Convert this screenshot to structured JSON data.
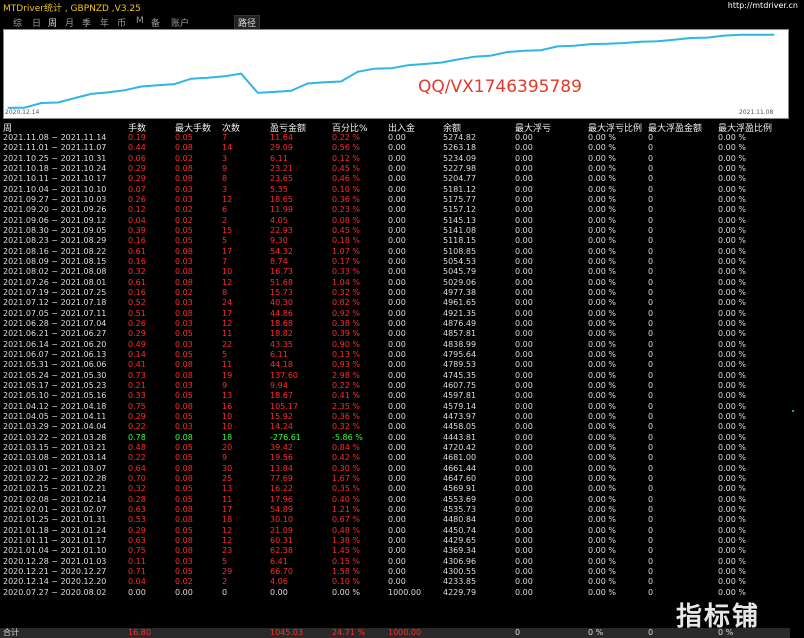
{
  "app": {
    "title": "MTDriver统计 , GBPNZD ,V3.25",
    "url": "http://mtdriver.cn"
  },
  "tabs": [
    "综",
    "日",
    "周",
    "月",
    "季",
    "年",
    "币",
    "M",
    "备",
    "账户"
  ],
  "active_tab": "周",
  "path_tab": "路径",
  "watermark": "QQ/VX1746395789",
  "logo_text": "指标铺",
  "chart": {
    "start_date": "2020.12.14",
    "end_date": "2021.11.08"
  },
  "chart_data": {
    "type": "area",
    "x": [
      "2020.07.27",
      "2020.12.14",
      "2020.12.21",
      "2020.12.28",
      "2021.01.04",
      "2021.01.11",
      "2021.01.18",
      "2021.01.25",
      "2021.02.01",
      "2021.02.08",
      "2021.02.15",
      "2021.02.22",
      "2021.03.01",
      "2021.03.08",
      "2021.03.15",
      "2021.03.22",
      "2021.03.29",
      "2021.04.05",
      "2021.04.12",
      "2021.04.19",
      "2021.05.10",
      "2021.05.17",
      "2021.05.24",
      "2021.05.31",
      "2021.06.07",
      "2021.06.14",
      "2021.06.21",
      "2021.06.28",
      "2021.07.05",
      "2021.07.12",
      "2021.07.19",
      "2021.07.26",
      "2021.08.02",
      "2021.08.09",
      "2021.08.16",
      "2021.08.23",
      "2021.08.30",
      "2021.09.06",
      "2021.09.13",
      "2021.09.20",
      "2021.09.27",
      "2021.10.04",
      "2021.10.11",
      "2021.10.18",
      "2021.10.25",
      "2021.11.01",
      "2021.11.08"
    ],
    "values": [
      4229.79,
      4233.85,
      4300.55,
      4306.96,
      4369.34,
      4429.65,
      4450.74,
      4480.84,
      4535.73,
      4553.69,
      4569.91,
      4647.6,
      4661.44,
      4681.0,
      4720.42,
      4443.81,
      4458.05,
      4473.97,
      4579.14,
      4597.81,
      4607.75,
      4745.35,
      4789.53,
      4795.64,
      4838.99,
      4857.81,
      4876.49,
      4921.35,
      4961.65,
      4977.38,
      5029.06,
      5045.79,
      5054.53,
      5108.85,
      5118.15,
      5141.08,
      5145.13,
      5157.12,
      5175.77,
      5181.12,
      5204.77,
      5227.98,
      5234.09,
      5263.18,
      5274.82,
      5274.82,
      5274.82
    ]
  },
  "headers": [
    "周",
    "手数",
    "最大手数",
    "次数",
    "盈亏金额",
    "百分比%",
    "出入金",
    "余额",
    "最大浮亏",
    "最大浮亏比例",
    "最大浮盈金额",
    "最大浮盈比例"
  ],
  "rows": [
    [
      "2021.11.08 ~ 2021.11.14",
      "0.19",
      "0.05",
      "7",
      "11.64",
      "0.22 %",
      "0.00",
      "5274.82",
      "0.00",
      "0.00 %",
      "0",
      "0.00 %"
    ],
    [
      "2021.11.01 ~ 2021.11.07",
      "0.44",
      "0.08",
      "14",
      "29.09",
      "0.56 %",
      "0.00",
      "5263.18",
      "0.00",
      "0.00 %",
      "0",
      "0.00 %"
    ],
    [
      "2021.10.25 ~ 2021.10.31",
      "0.06",
      "0.02",
      "3",
      "6.11",
      "0.12 %",
      "0.00",
      "5234.09",
      "0.00",
      "0.00 %",
      "0",
      "0.00 %"
    ],
    [
      "2021.10.18 ~ 2021.10.24",
      "0.29",
      "0.08",
      "9",
      "23.21",
      "0.45 %",
      "0.00",
      "5227.98",
      "0.00",
      "0.00 %",
      "0",
      "0.00 %"
    ],
    [
      "2021.10.11 ~ 2021.10.17",
      "0.29",
      "0.08",
      "8",
      "23.65",
      "0.46 %",
      "0.00",
      "5204.77",
      "0.00",
      "0.00 %",
      "0",
      "0.00 %"
    ],
    [
      "2021.10.04 ~ 2021.10.10",
      "0.07",
      "0.03",
      "3",
      "5.35",
      "0.10 %",
      "0.00",
      "5181.12",
      "0.00",
      "0.00 %",
      "0",
      "0.00 %"
    ],
    [
      "2021.09.27 ~ 2021.10.03",
      "0.26",
      "0.03",
      "12",
      "18.65",
      "0.36 %",
      "0.00",
      "5175.77",
      "0.00",
      "0.00 %",
      "0",
      "0.00 %"
    ],
    [
      "2021.09.20 ~ 2021.09.26",
      "0.12",
      "0.02",
      "6",
      "11.99",
      "0.23 %",
      "0.00",
      "5157.12",
      "0.00",
      "0.00 %",
      "0",
      "0.00 %"
    ],
    [
      "2021.09.06 ~ 2021.09.12",
      "0.04",
      "0.02",
      "2",
      "4.05",
      "0.08 %",
      "0.00",
      "5145.13",
      "0.00",
      "0.00 %",
      "0",
      "0.00 %"
    ],
    [
      "2021.08.30 ~ 2021.09.05",
      "0.39",
      "0.05",
      "15",
      "22.93",
      "0.45 %",
      "0.00",
      "5141.08",
      "0.00",
      "0.00 %",
      "0",
      "0.00 %"
    ],
    [
      "2021.08.23 ~ 2021.08.29",
      "0.16",
      "0.05",
      "5",
      "9.30",
      "0.18 %",
      "0.00",
      "5118.15",
      "0.00",
      "0.00 %",
      "0",
      "0.00 %"
    ],
    [
      "2021.08.16 ~ 2021.08.22",
      "0.61",
      "0.08",
      "17",
      "54.32",
      "1.07 %",
      "0.00",
      "5108.85",
      "0.00",
      "0.00 %",
      "0",
      "0.00 %"
    ],
    [
      "2021.08.09 ~ 2021.08.15",
      "0.16",
      "0.03",
      "7",
      "8.74",
      "0.17 %",
      "0.00",
      "5054.53",
      "0.00",
      "0.00 %",
      "0",
      "0.00 %"
    ],
    [
      "2021.08.02 ~ 2021.08.08",
      "0.32",
      "0.08",
      "10",
      "16.73",
      "0.33 %",
      "0.00",
      "5045.79",
      "0.00",
      "0.00 %",
      "0",
      "0.00 %"
    ],
    [
      "2021.07.26 ~ 2021.08.01",
      "0.61",
      "0.08",
      "12",
      "51.68",
      "1.04 %",
      "0.00",
      "5029.06",
      "0.00",
      "0.00 %",
      "0",
      "0.00 %"
    ],
    [
      "2021.07.19 ~ 2021.07.25",
      "0.16",
      "0.02",
      "8",
      "15.73",
      "0.32 %",
      "0.00",
      "4977.38",
      "0.00",
      "0.00 %",
      "0",
      "0.00 %"
    ],
    [
      "2021.07.12 ~ 2021.07.18",
      "0.52",
      "0.03",
      "24",
      "40.30",
      "0.82 %",
      "0.00",
      "4961.65",
      "0.00",
      "0.00 %",
      "0",
      "0.00 %"
    ],
    [
      "2021.07.05 ~ 2021.07.11",
      "0.51",
      "0.08",
      "17",
      "44.86",
      "0.92 %",
      "0.00",
      "4921.35",
      "0.00",
      "0.00 %",
      "0",
      "0.00 %"
    ],
    [
      "2021.06.28 ~ 2021.07.04",
      "0.26",
      "0.03",
      "12",
      "18.68",
      "0.38 %",
      "0.00",
      "4876.49",
      "0.00",
      "0.00 %",
      "0",
      "0.00 %"
    ],
    [
      "2021.06.21 ~ 2021.06.27",
      "0.29",
      "0.05",
      "11",
      "18.82",
      "0.39 %",
      "0.00",
      "4857.81",
      "0.00",
      "0.00 %",
      "0",
      "0.00 %"
    ],
    [
      "2021.06.14 ~ 2021.06.20",
      "0.49",
      "0.03",
      "22",
      "43.35",
      "0.90 %",
      "0.00",
      "4838.99",
      "0.00",
      "0.00 %",
      "0",
      "0.00 %"
    ],
    [
      "2021.06.07 ~ 2021.06.13",
      "0.14",
      "0.05",
      "5",
      "6.11",
      "0.13 %",
      "0.00",
      "4795.64",
      "0.00",
      "0.00 %",
      "0",
      "0.00 %"
    ],
    [
      "2021.05.31 ~ 2021.06.06",
      "0.41",
      "0.08",
      "11",
      "44.18",
      "0.93 %",
      "0.00",
      "4789.53",
      "0.00",
      "0.00 %",
      "0",
      "0.00 %"
    ],
    [
      "2021.05.24 ~ 2021.05.30",
      "0.73",
      "0.08",
      "19",
      "137.60",
      "2.98 %",
      "0.00",
      "4745.35",
      "0.00",
      "0.00 %",
      "0",
      "0.00 %"
    ],
    [
      "2021.05.17 ~ 2021.05.23",
      "0.21",
      "0.03",
      "9",
      "9.94",
      "0.22 %",
      "0.00",
      "4607.75",
      "0.00",
      "0.00 %",
      "0",
      "0.00 %"
    ],
    [
      "2021.05.10 ~ 2021.05.16",
      "0.33",
      "0.05",
      "13",
      "18.67",
      "0.41 %",
      "0.00",
      "4597.81",
      "0.00",
      "0.00 %",
      "0",
      "0.00 %"
    ],
    [
      "2021.04.12 ~ 2021.04.18",
      "0.75",
      "0.08",
      "16",
      "105.17",
      "2.35 %",
      "0.00",
      "4579.14",
      "0.00",
      "0.00 %",
      "0",
      "0.00 %"
    ],
    [
      "2021.04.05 ~ 2021.04.11",
      "0.29",
      "0.05",
      "10",
      "15.92",
      "0.36 %",
      "0.00",
      "4473.97",
      "0.00",
      "0.00 %",
      "0",
      "0.00 %"
    ],
    [
      "2021.03.29 ~ 2021.04.04",
      "0.22",
      "0.03",
      "10",
      "14.24",
      "0.32 %",
      "0.00",
      "4458.05",
      "0.00",
      "0.00 %",
      "0",
      "0.00 %"
    ],
    [
      "2021.03.22 ~ 2021.03.28",
      "0.78",
      "0.08",
      "18",
      "-276.61",
      "-5.86 %",
      "0.00",
      "4443.81",
      "0.00",
      "0.00 %",
      "0",
      "0.00 %"
    ],
    [
      "2021.03.15 ~ 2021.03.21",
      "0.48",
      "0.05",
      "20",
      "39.42",
      "0.84 %",
      "0.00",
      "4720.42",
      "0.00",
      "0.00 %",
      "0",
      "0.00 %"
    ],
    [
      "2021.03.08 ~ 2021.03.14",
      "0.22",
      "0.05",
      "9",
      "19.56",
      "0.42 %",
      "0.00",
      "4681.00",
      "0.00",
      "0.00 %",
      "0",
      "0.00 %"
    ],
    [
      "2021.03.01 ~ 2021.03.07",
      "0.64",
      "0.08",
      "30",
      "13.84",
      "0.30 %",
      "0.00",
      "4661.44",
      "0.00",
      "0.00 %",
      "0",
      "0.00 %"
    ],
    [
      "2021.02.22 ~ 2021.02.28",
      "0.70",
      "0.08",
      "25",
      "77.69",
      "1.67 %",
      "0.00",
      "4647.60",
      "0.00",
      "0.00 %",
      "0",
      "0.00 %"
    ],
    [
      "2021.02.15 ~ 2021.02.21",
      "0.32",
      "0.05",
      "13",
      "16.22",
      "0.35 %",
      "0.00",
      "4569.91",
      "0.00",
      "0.00 %",
      "0",
      "0.00 %"
    ],
    [
      "2021.02.08 ~ 2021.02.14",
      "0.28",
      "0.05",
      "11",
      "17.96",
      "0.40 %",
      "0.00",
      "4553.69",
      "0.00",
      "0.00 %",
      "0",
      "0.00 %"
    ],
    [
      "2021.02.01 ~ 2021.02.07",
      "0.63",
      "0.08",
      "17",
      "54.89",
      "1.21 %",
      "0.00",
      "4535.73",
      "0.00",
      "0.00 %",
      "0",
      "0.00 %"
    ],
    [
      "2021.01.25 ~ 2021.01.31",
      "0.53",
      "0.08",
      "18",
      "30.10",
      "0.67 %",
      "0.00",
      "4480.84",
      "0.00",
      "0.00 %",
      "0",
      "0.00 %"
    ],
    [
      "2021.01.18 ~ 2021.01.24",
      "0.29",
      "0.05",
      "12",
      "21.09",
      "0.48 %",
      "0.00",
      "4450.74",
      "0.00",
      "0.00 %",
      "0",
      "0.00 %"
    ],
    [
      "2021.01.11 ~ 2021.01.17",
      "0.63",
      "0.08",
      "12",
      "60.31",
      "1.38 %",
      "0.00",
      "4429.65",
      "0.00",
      "0.00 %",
      "0",
      "0.00 %"
    ],
    [
      "2021.01.04 ~ 2021.01.10",
      "0.75",
      "0.08",
      "23",
      "62.38",
      "1.45 %",
      "0.00",
      "4369.34",
      "0.00",
      "0.00 %",
      "0",
      "0.00 %"
    ],
    [
      "2020.12.28 ~ 2021.01.03",
      "0.11",
      "0.03",
      "5",
      "6.41",
      "0.15 %",
      "0.00",
      "4306.96",
      "0.00",
      "0.00 %",
      "0",
      "0.00 %"
    ],
    [
      "2020.12.21 ~ 2020.12.27",
      "0.71",
      "0.05",
      "29",
      "66.70",
      "1.58 %",
      "0.00",
      "4300.55",
      "0.00",
      "0.00 %",
      "0",
      "0.00 %"
    ],
    [
      "2020.12.14 ~ 2020.12.20",
      "0.04",
      "0.02",
      "2",
      "4.06",
      "0.10 %",
      "0.00",
      "4233.85",
      "0.00",
      "0.00 %",
      "0",
      "0.00 %"
    ],
    [
      "2020.07.27 ~ 2020.08.02",
      "0.00",
      "0.00",
      "0",
      "0.00",
      "0.00 %",
      "1000.00",
      "4229.79",
      "0.00",
      "0.00 %",
      "0",
      "0.00 %"
    ]
  ],
  "footer": [
    "合计",
    "16.80",
    "",
    "",
    "1045.03",
    "24.71 %",
    "1000.00",
    "",
    "0",
    "0 %",
    "0",
    "0 %"
  ],
  "colors": {
    "positive": "#ff2b2b",
    "negative": "#33ff33",
    "neutral": "#dddddd",
    "line": "#2fb6e6"
  }
}
